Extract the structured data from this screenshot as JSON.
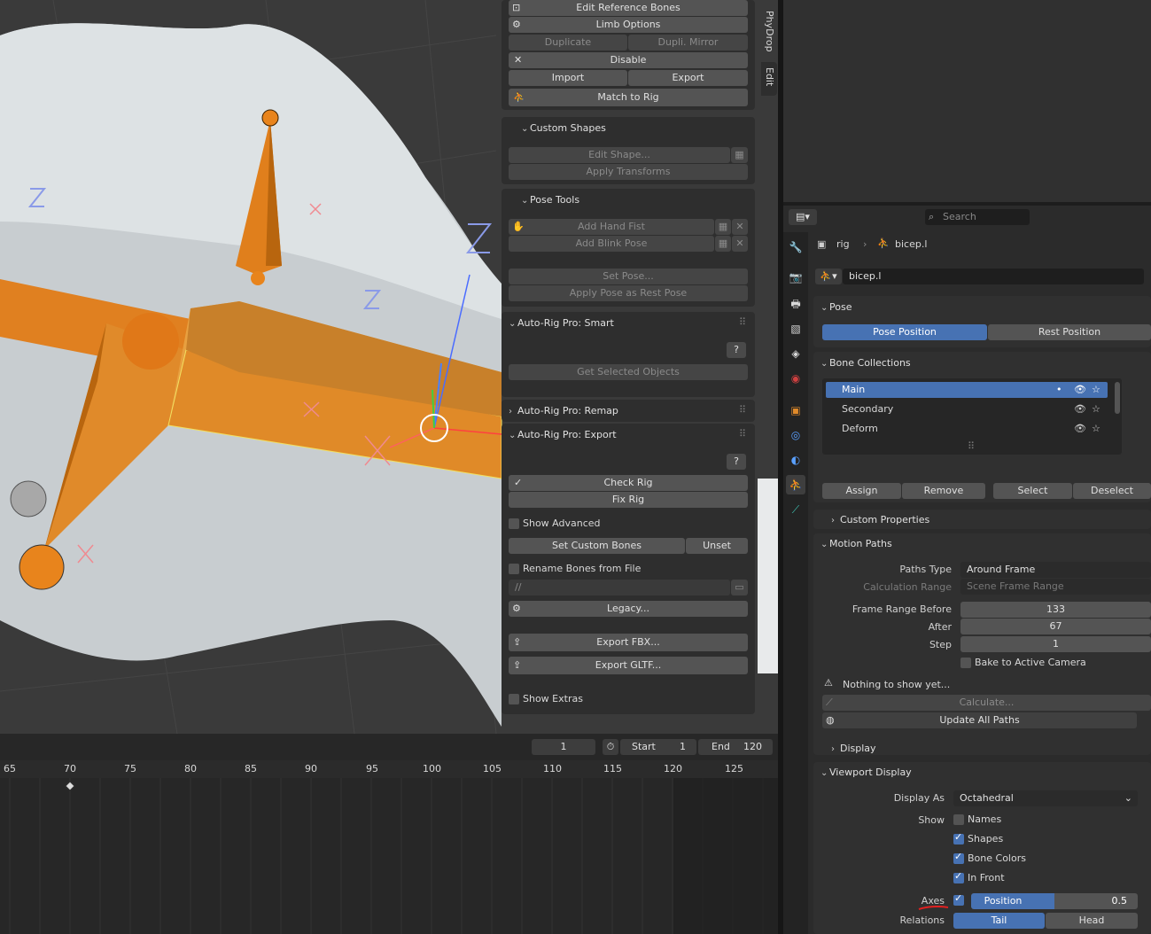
{
  "npanel_top": {
    "edit_ref_bones": "Edit Reference Bones",
    "limb_options": "Limb Options",
    "duplicate": "Duplicate",
    "dupli_mirror": "Dupli. Mirror",
    "disable": "Disable",
    "import": "Import",
    "export": "Export",
    "match_to_rig": "Match to Rig"
  },
  "custom_shapes": {
    "header": "Custom Shapes",
    "edit_shape": "Edit Shape...",
    "apply_transforms": "Apply Transforms"
  },
  "pose_tools": {
    "header": "Pose Tools",
    "add_hand_fist": "Add Hand Fist",
    "add_blink_pose": "Add Blink Pose",
    "set_pose": "Set Pose...",
    "apply_rest": "Apply Pose as Rest Pose"
  },
  "smart": {
    "header": "Auto-Rig Pro: Smart",
    "get_selected": "Get Selected Objects",
    "help": "?"
  },
  "remap": {
    "header": "Auto-Rig Pro: Remap"
  },
  "export_panel": {
    "header": "Auto-Rig Pro: Export",
    "help": "?",
    "check_rig": "Check Rig",
    "fix_rig": "Fix Rig",
    "show_advanced": "Show Advanced",
    "set_custom_bones": "Set Custom Bones",
    "unset": "Unset",
    "rename_from_file": "Rename Bones from File",
    "path": "//",
    "legacy": "Legacy...",
    "export_fbx": "Export FBX...",
    "export_gltf": "Export GLTF...",
    "show_extras": "Show Extras"
  },
  "side_tabs": {
    "phydrop": "PhyDrop",
    "edit": "Edit"
  },
  "timeline": {
    "current_frame": "1",
    "start_label": "Start",
    "start": "1",
    "end_label": "End",
    "end": "120",
    "ticks": [
      "65",
      "70",
      "75",
      "80",
      "85",
      "90",
      "95",
      "100",
      "105",
      "110",
      "115",
      "120",
      "125"
    ]
  },
  "props": {
    "search_placeholder": "Search",
    "breadcrumb_obj": "rig",
    "breadcrumb_bone": "bicep.l",
    "bone_name": "bicep.l",
    "pose": {
      "header": "Pose",
      "pose_position": "Pose Position",
      "rest_position": "Rest Position"
    },
    "bone_collections": {
      "header": "Bone Collections",
      "items": [
        "Main",
        "Secondary",
        "Deform"
      ],
      "assign": "Assign",
      "remove": "Remove",
      "select": "Select",
      "deselect": "Deselect"
    },
    "custom_properties": "Custom Properties",
    "motion_paths": {
      "header": "Motion Paths",
      "paths_type_label": "Paths Type",
      "paths_type": "Around Frame",
      "calc_range_label": "Calculation Range",
      "calc_range": "Scene Frame Range",
      "frame_before_label": "Frame Range Before",
      "frame_before": "133",
      "after_label": "After",
      "after": "67",
      "step_label": "Step",
      "step": "1",
      "bake": "Bake to Active Camera",
      "nothing": "Nothing to show yet...",
      "calculate": "Calculate...",
      "update_all": "Update All Paths"
    },
    "display": "Display",
    "viewport_display": {
      "header": "Viewport Display",
      "display_as_label": "Display As",
      "display_as": "Octahedral",
      "show_label": "Show",
      "names": "Names",
      "shapes": "Shapes",
      "bone_colors": "Bone Colors",
      "in_front": "In Front",
      "axes_label": "Axes",
      "position": "Position",
      "position_val": "0.5",
      "relations_label": "Relations",
      "tail": "Tail",
      "head": "Head"
    }
  }
}
